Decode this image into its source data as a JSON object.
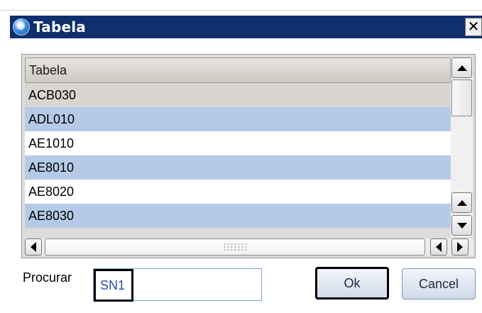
{
  "window": {
    "title": "Tabela",
    "close_label": "✕"
  },
  "grid": {
    "column_header": "Tabela",
    "rows": [
      {
        "value": "ACB030",
        "state": "focused"
      },
      {
        "value": "ADL010",
        "state": "selected"
      },
      {
        "value": "AE1010",
        "state": "normal"
      },
      {
        "value": "AE8010",
        "state": "selected"
      },
      {
        "value": "AE8020",
        "state": "normal"
      },
      {
        "value": "AE8030",
        "state": "selected"
      }
    ]
  },
  "search": {
    "label": "Procurar",
    "value": "SN1"
  },
  "buttons": {
    "ok_label": "Ok",
    "cancel_label": "Cancel"
  },
  "colors": {
    "titlebar": "#0f2f6e",
    "selected_row": "#b5cae6",
    "focused_row": "#d9d6d1"
  }
}
